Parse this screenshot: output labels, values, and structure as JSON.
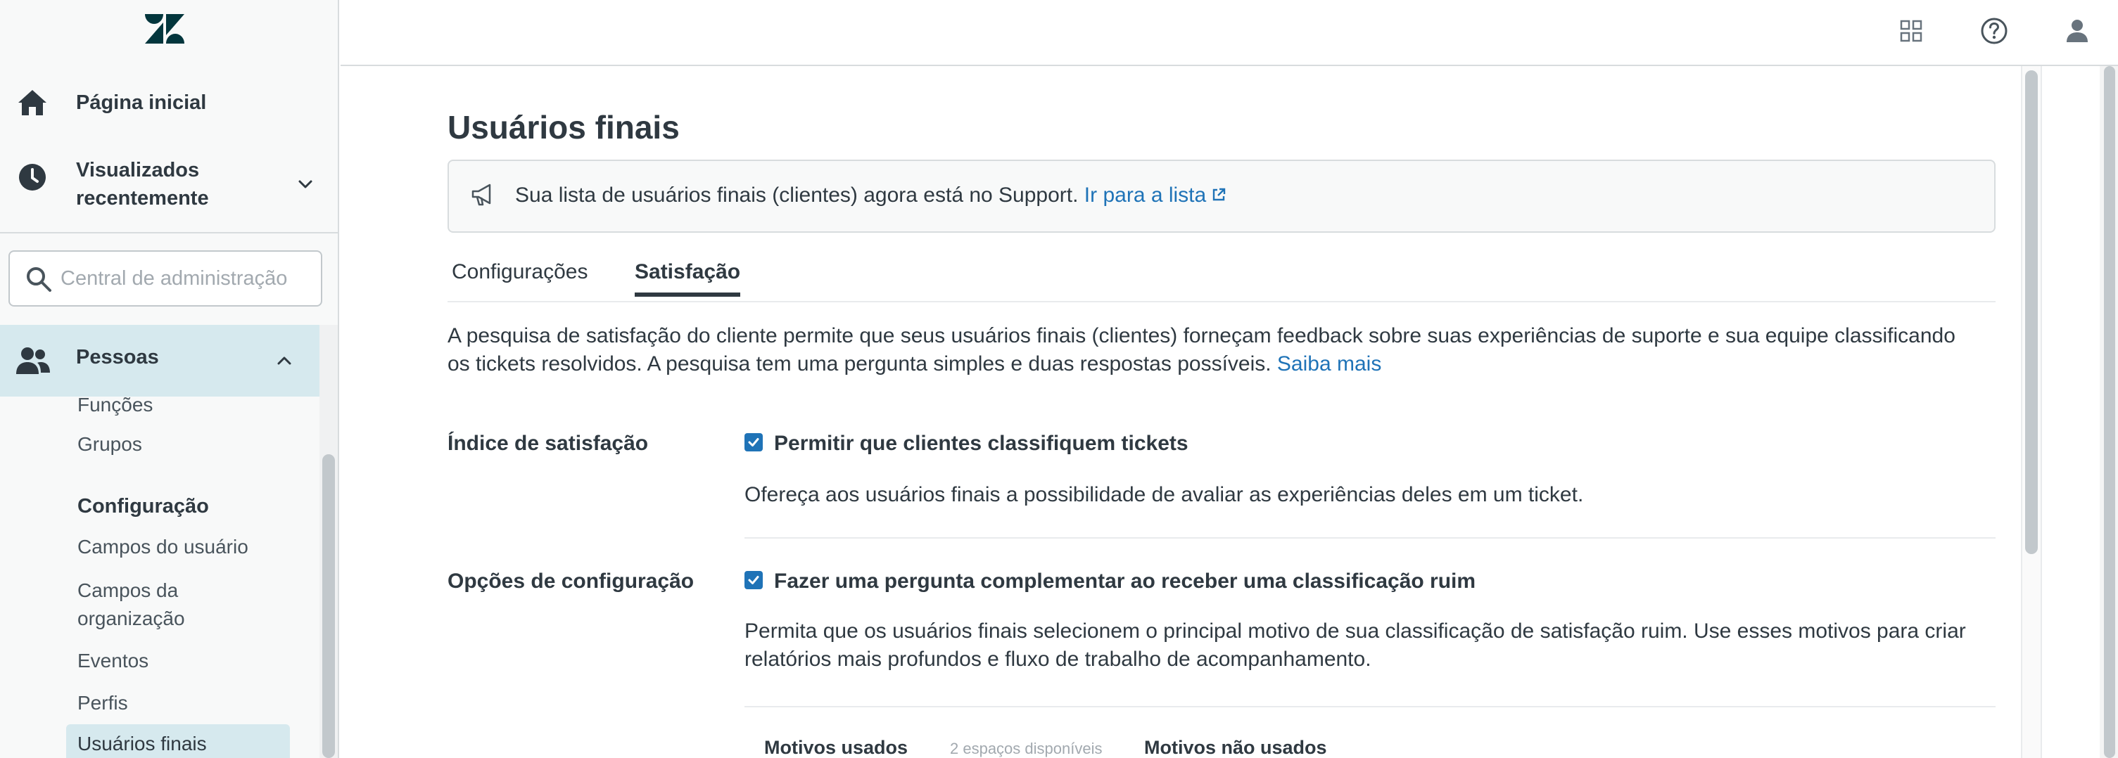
{
  "colors": {
    "accent": "#1f73b7",
    "text": "#2f3941",
    "muted_text": "#a2a9af",
    "active_bg": "#d6e9ee",
    "sidebar_bg": "#f8f9f9",
    "border": "#d8dcde"
  },
  "sidebar": {
    "logo_icon": "zendesk-logo",
    "nav": [
      {
        "label": "Página inicial",
        "icon": "home-icon"
      },
      {
        "label": "Visualizados recentemente",
        "icon": "clock-icon",
        "chevron": "chevron-down-icon"
      }
    ],
    "search": {
      "placeholder": "Central de administração",
      "value": "",
      "icon": "search-icon"
    },
    "section": {
      "label": "Pessoas",
      "icon": "people-icon",
      "expanded": true
    },
    "items_top": [
      "Funções",
      "Grupos"
    ],
    "config_heading": "Configuração",
    "config_items": [
      "Campos do usuário",
      "Campos da organização",
      "Eventos",
      "Perfis",
      "Usuários finais"
    ],
    "active_item": "Usuários finais"
  },
  "topbar": {
    "icons": [
      "grid-icon",
      "help-icon",
      "user-icon"
    ]
  },
  "main": {
    "title": "Usuários finais",
    "notice": {
      "icon": "megaphone-icon",
      "text": "Sua lista de usuários finais (clientes) agora está no Support. ",
      "link_text": "Ir para a lista",
      "link_icon": "external-link-icon"
    },
    "tabs": [
      {
        "label": "Configurações",
        "selected": false
      },
      {
        "label": "Satisfação",
        "selected": true
      }
    ],
    "intro": {
      "text": "A pesquisa de satisfação do cliente permite que seus usuários finais (clientes) forneçam feedback sobre suas experiências de suporte e sua equipe classificando os tickets resolvidos. A pesquisa tem uma pergunta simples e duas respostas possíveis. ",
      "link_text": "Saiba mais"
    },
    "satisfaction_index": {
      "label": "Índice de satisfação",
      "checkbox_label": "Permitir que clientes classifiquem tickets",
      "checked": true,
      "description": "Ofereça aos usuários finais a possibilidade de avaliar as experiências deles em um ticket."
    },
    "config_options": {
      "label": "Opções de configuração",
      "checkbox_label": "Fazer uma pergunta complementar ao receber uma classificação ruim",
      "checked": true,
      "description": "Permita que os usuários finais selecionem o principal motivo de sua classificação de satisfação ruim. Use esses motivos para criar relatórios mais profundos e fluxo de trabalho de acompanhamento."
    },
    "reasons": {
      "used_label": "Motivos usados",
      "slots_available": "2 espaços disponíveis",
      "unused_label": "Motivos não usados"
    }
  }
}
